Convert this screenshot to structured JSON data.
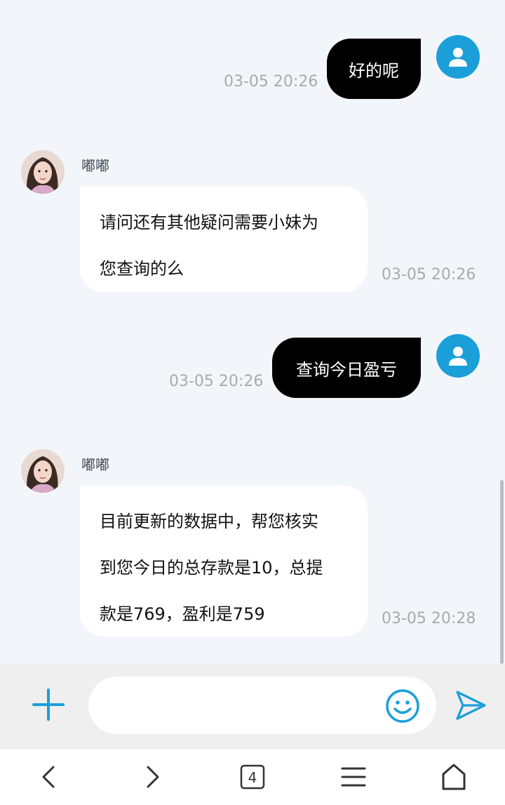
{
  "messages": [
    {
      "side": "out",
      "text": "好的呢",
      "time": "03-05 20:26"
    },
    {
      "side": "in",
      "sender": "嘟嘟",
      "lines": [
        "请问还有其他疑问需要小妹为",
        "您查询的么"
      ],
      "time": "03-05 20:26"
    },
    {
      "side": "out",
      "text": "查询今日盈亏",
      "time": "03-05 20:26"
    },
    {
      "side": "in",
      "sender": "嘟嘟",
      "lines": [
        "目前更新的数据中，帮您核实",
        "到您今日的总存款是10，总提",
        "款是769，盈利是759"
      ],
      "time": "03-05 20:28"
    }
  ],
  "composer": {
    "placeholder": "",
    "plus_icon": "plus-icon",
    "emoji_icon": "smiley-icon",
    "send_icon": "send-icon"
  },
  "navbar": {
    "tab_count": "4",
    "icons": [
      "back-icon",
      "forward-icon",
      "tabs-icon",
      "menu-icon",
      "home-icon"
    ]
  },
  "colors": {
    "accent": "#1a9fd9",
    "out_bubble": "#000000",
    "in_bubble": "#ffffff",
    "background": "#f2f6fa"
  }
}
